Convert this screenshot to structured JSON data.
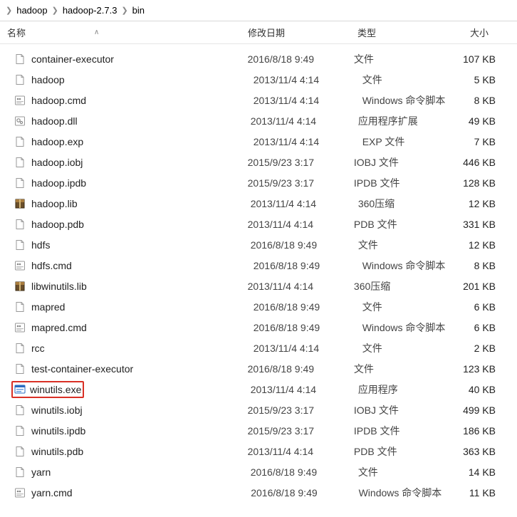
{
  "breadcrumb": {
    "items": [
      "hadoop",
      "hadoop-2.7.3",
      "bin"
    ]
  },
  "columns": {
    "name": "名称",
    "date": "修改日期",
    "type": "类型",
    "size": "大小"
  },
  "files": [
    {
      "name": "container-executor",
      "date": "2016/8/18 9:49",
      "type": "文件",
      "size": "107 KB",
      "icon": "file"
    },
    {
      "name": "hadoop",
      "date": "2013/11/4 4:14",
      "type": "文件",
      "size": "5 KB",
      "icon": "file"
    },
    {
      "name": "hadoop.cmd",
      "date": "2013/11/4 4:14",
      "type": "Windows 命令脚本",
      "size": "8 KB",
      "icon": "cmd"
    },
    {
      "name": "hadoop.dll",
      "date": "2013/11/4 4:14",
      "type": "应用程序扩展",
      "size": "49 KB",
      "icon": "dll"
    },
    {
      "name": "hadoop.exp",
      "date": "2013/11/4 4:14",
      "type": "EXP 文件",
      "size": "7 KB",
      "icon": "file"
    },
    {
      "name": "hadoop.iobj",
      "date": "2015/9/23 3:17",
      "type": "IOBJ 文件",
      "size": "446 KB",
      "icon": "file"
    },
    {
      "name": "hadoop.ipdb",
      "date": "2015/9/23 3:17",
      "type": "IPDB 文件",
      "size": "128 KB",
      "icon": "file"
    },
    {
      "name": "hadoop.lib",
      "date": "2013/11/4 4:14",
      "type": "360压缩",
      "size": "12 KB",
      "icon": "archive"
    },
    {
      "name": "hadoop.pdb",
      "date": "2013/11/4 4:14",
      "type": "PDB 文件",
      "size": "331 KB",
      "icon": "file"
    },
    {
      "name": "hdfs",
      "date": "2016/8/18 9:49",
      "type": "文件",
      "size": "12 KB",
      "icon": "file"
    },
    {
      "name": "hdfs.cmd",
      "date": "2016/8/18 9:49",
      "type": "Windows 命令脚本",
      "size": "8 KB",
      "icon": "cmd"
    },
    {
      "name": "libwinutils.lib",
      "date": "2013/11/4 4:14",
      "type": "360压缩",
      "size": "201 KB",
      "icon": "archive"
    },
    {
      "name": "mapred",
      "date": "2016/8/18 9:49",
      "type": "文件",
      "size": "6 KB",
      "icon": "file"
    },
    {
      "name": "mapred.cmd",
      "date": "2016/8/18 9:49",
      "type": "Windows 命令脚本",
      "size": "6 KB",
      "icon": "cmd"
    },
    {
      "name": "rcc",
      "date": "2013/11/4 4:14",
      "type": "文件",
      "size": "2 KB",
      "icon": "file"
    },
    {
      "name": "test-container-executor",
      "date": "2016/8/18 9:49",
      "type": "文件",
      "size": "123 KB",
      "icon": "file"
    },
    {
      "name": "winutils.exe",
      "date": "2013/11/4 4:14",
      "type": "应用程序",
      "size": "40 KB",
      "icon": "exe",
      "highlight": true
    },
    {
      "name": "winutils.iobj",
      "date": "2015/9/23 3:17",
      "type": "IOBJ 文件",
      "size": "499 KB",
      "icon": "file"
    },
    {
      "name": "winutils.ipdb",
      "date": "2015/9/23 3:17",
      "type": "IPDB 文件",
      "size": "186 KB",
      "icon": "file"
    },
    {
      "name": "winutils.pdb",
      "date": "2013/11/4 4:14",
      "type": "PDB 文件",
      "size": "363 KB",
      "icon": "file"
    },
    {
      "name": "yarn",
      "date": "2016/8/18 9:49",
      "type": "文件",
      "size": "14 KB",
      "icon": "file"
    },
    {
      "name": "yarn.cmd",
      "date": "2016/8/18 9:49",
      "type": "Windows 命令脚本",
      "size": "11 KB",
      "icon": "cmd"
    }
  ]
}
